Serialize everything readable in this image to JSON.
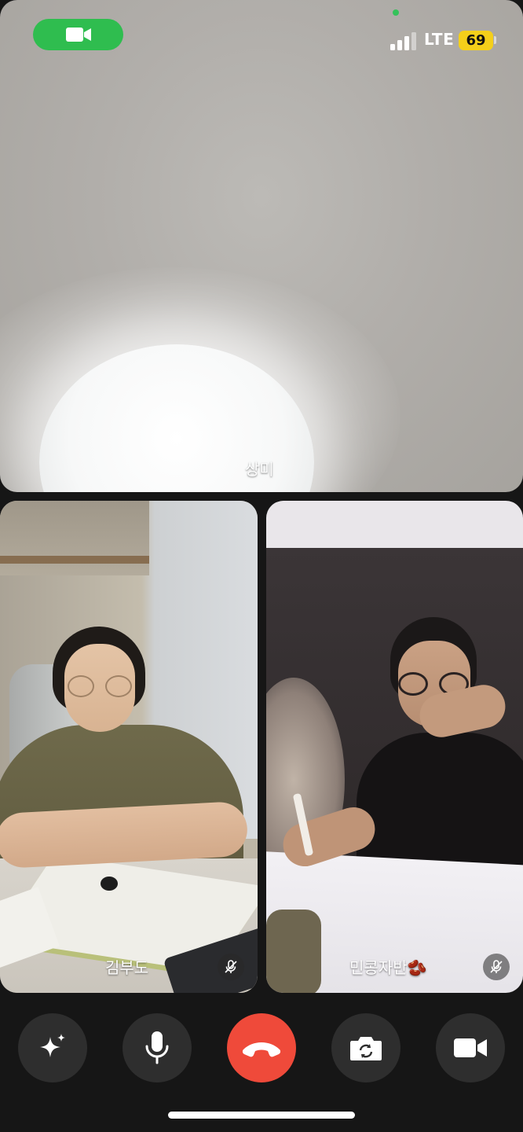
{
  "status_bar": {
    "network": "LTE",
    "battery": "69"
  },
  "participants": [
    {
      "name": "상미"
    },
    {
      "name": "김부도",
      "muted": true
    },
    {
      "name": "민콩자반",
      "emoji": "🫘",
      "muted": true
    }
  ],
  "controls": [
    {
      "icon": "sparkle-icon"
    },
    {
      "icon": "microphone-icon"
    },
    {
      "icon": "end-call-icon",
      "color": "#ef4a3a"
    },
    {
      "icon": "flip-camera-icon"
    },
    {
      "icon": "video-camera-icon"
    }
  ],
  "colors": {
    "call_pill": "#2fbd4f",
    "battery": "#f4cf1a",
    "end_call": "#ef4a3a"
  }
}
